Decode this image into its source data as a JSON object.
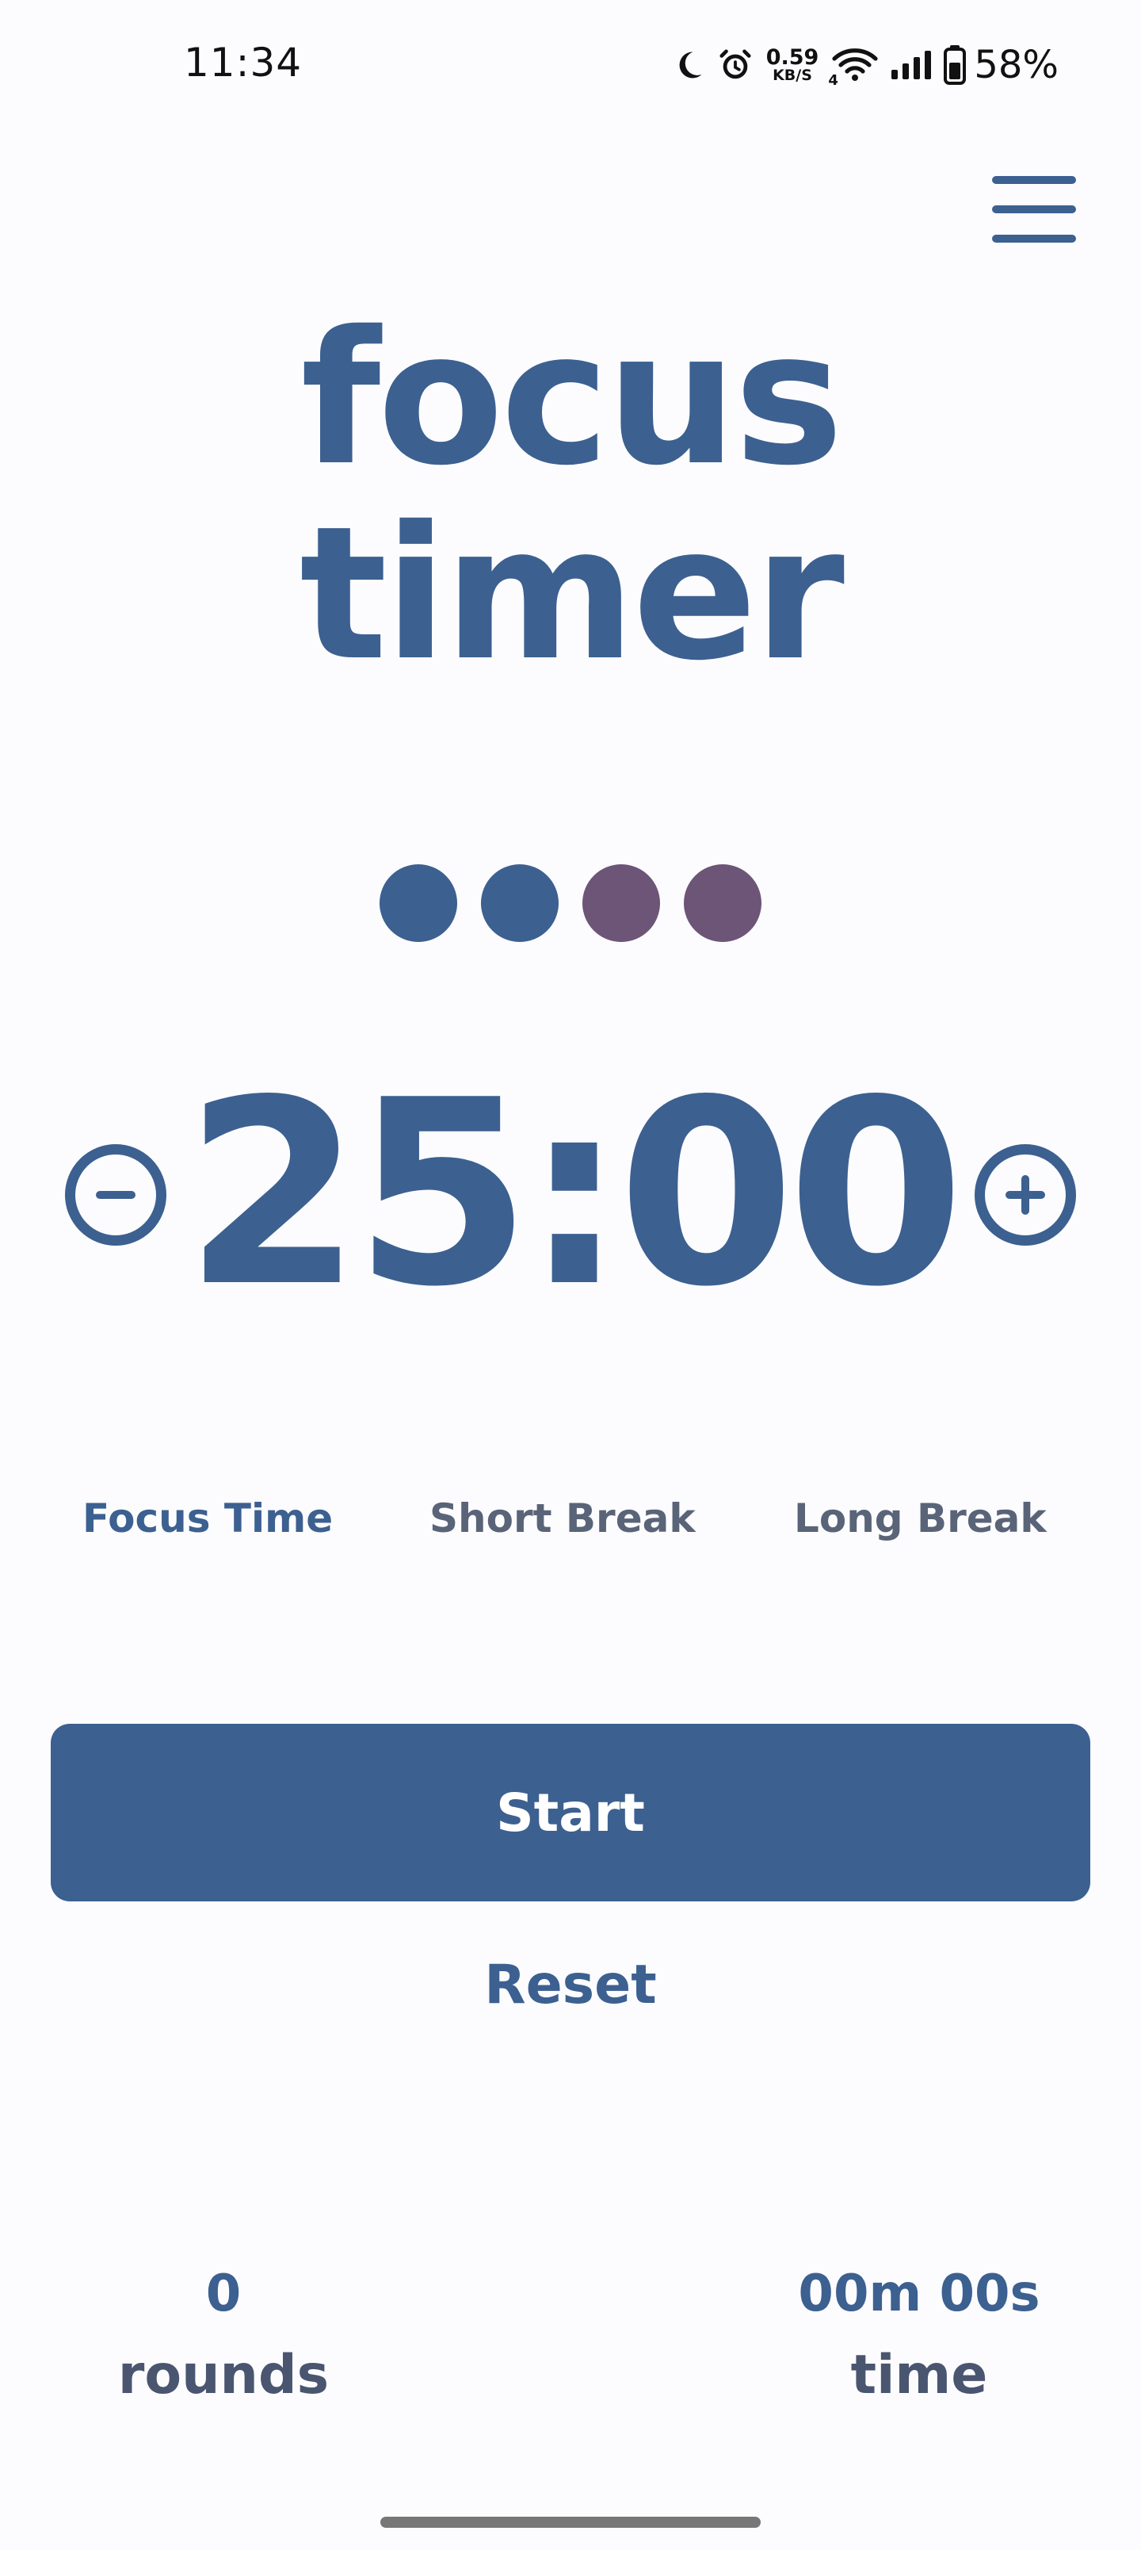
{
  "status_bar": {
    "time": "11:34",
    "net_speed_value": "0.59",
    "net_speed_unit": "KB/S",
    "network_label": "4",
    "battery_percent": "58%",
    "icons": [
      "moon-icon",
      "alarm-icon",
      "wifi-icon",
      "signal-icon",
      "battery-icon"
    ]
  },
  "header": {
    "menu_icon": "hamburger-menu-icon"
  },
  "title": {
    "line1": "focus",
    "line2": "timer"
  },
  "rounds_indicator": {
    "dots": [
      {
        "state": "completed",
        "color": "#3c6090"
      },
      {
        "state": "completed",
        "color": "#3c6090"
      },
      {
        "state": "remaining",
        "color": "#6d5577"
      },
      {
        "state": "remaining",
        "color": "#6d5577"
      }
    ]
  },
  "timer": {
    "display": "25:00",
    "decrease_icon": "minus-circle-icon",
    "increase_icon": "plus-circle-icon"
  },
  "modes": {
    "items": [
      {
        "label": "Focus Time",
        "active": true
      },
      {
        "label": "Short Break",
        "active": false
      },
      {
        "label": "Long Break",
        "active": false
      }
    ]
  },
  "controls": {
    "start_label": "Start",
    "reset_label": "Reset"
  },
  "stats": {
    "rounds_value": "0",
    "rounds_label": "rounds",
    "time_value": "00m 00s",
    "time_label": "time"
  },
  "colors": {
    "primary": "#3c6090",
    "secondary_text": "#5a6478",
    "dot_remaining": "#6d5577",
    "background": "#fcfcfe"
  }
}
